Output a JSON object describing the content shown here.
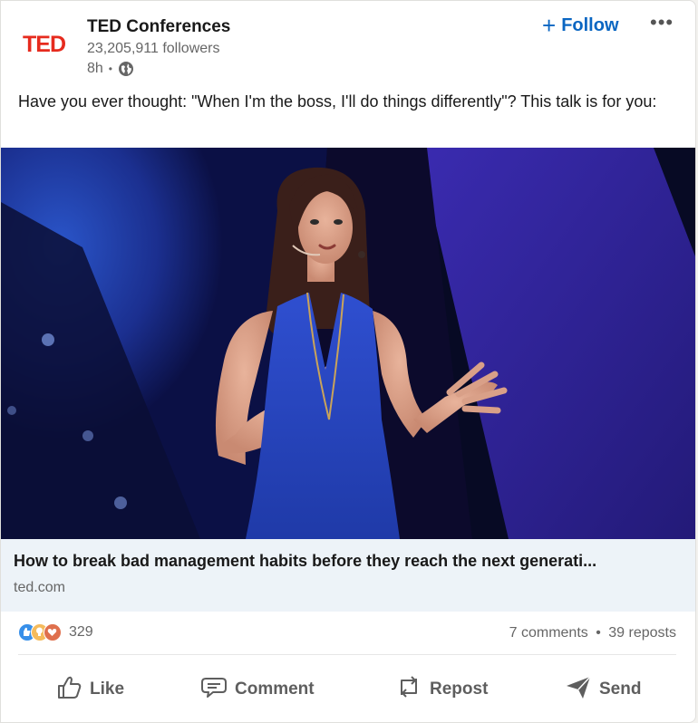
{
  "post": {
    "author": {
      "logo_text": "TED",
      "name": "TED Conferences",
      "followers": "23,205,911 followers",
      "time": "8h",
      "separator": "•",
      "visibility_icon": "globe-icon"
    },
    "follow_label": "Follow",
    "follow_prefix": "+",
    "more_label": "•••",
    "text": "Have you ever thought: \"When I'm the boss, I'll do things differently\"? This talk is for you:",
    "link": {
      "title": "How to break bad management habits before they reach the next generati...",
      "domain": "ted.com"
    },
    "social": {
      "reaction_count": "329",
      "comments": "7 comments",
      "dot": "•",
      "reposts": "39 reposts"
    },
    "actions": [
      {
        "label": "Like",
        "icon": "thumbs-up-icon"
      },
      {
        "label": "Comment",
        "icon": "comment-icon"
      },
      {
        "label": "Repost",
        "icon": "repost-icon"
      },
      {
        "label": "Send",
        "icon": "send-icon"
      }
    ]
  },
  "colors": {
    "brand_red": "#e62b1e",
    "link_blue": "#0a66c2",
    "link_box_bg": "#edf3f8",
    "muted_text": "#666666"
  }
}
